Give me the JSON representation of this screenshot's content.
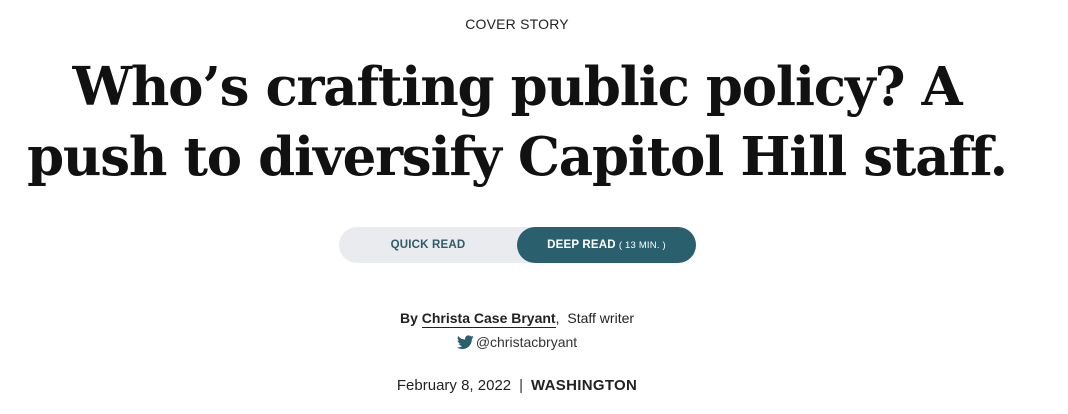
{
  "article": {
    "kicker": "COVER STORY",
    "headline": "Who’s crafting public policy? A push to diversify Capitol Hill staff.",
    "read_toggle": {
      "quick_label": "QUICK READ",
      "deep_label": "DEEP READ",
      "deep_minutes": "( 13 MIN. )",
      "selected": "DEEP READ"
    },
    "byline": {
      "prefix": "By",
      "author": "Christa Case Bryant",
      "role": "Staff writer",
      "twitter_handle": "@christacbryant"
    },
    "dateline": {
      "date": "February 8, 2022",
      "separator": "|",
      "location": "WASHINGTON"
    }
  },
  "icons": {
    "twitter": "twitter-bird-icon"
  },
  "colors": {
    "accent": "#2a5f6e",
    "toggle_track": "#e9ebee",
    "twitter_blue": "#2a5f6e"
  }
}
